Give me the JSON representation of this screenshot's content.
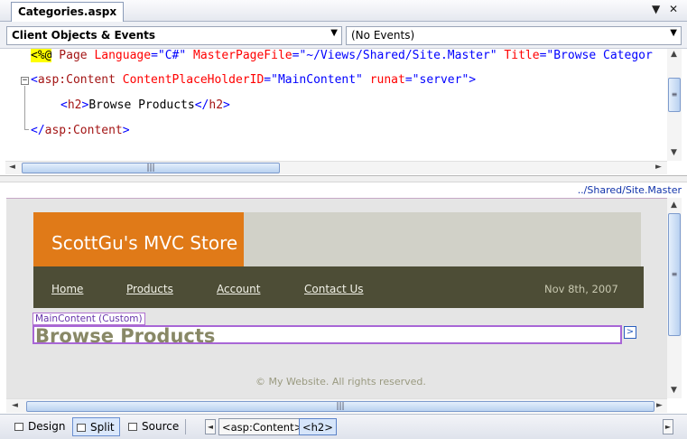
{
  "document_tab": {
    "title": "Categories.aspx"
  },
  "window_controls": {
    "menu": "▼",
    "close": "✕"
  },
  "dropdowns": {
    "objects": "Client Objects & Events",
    "events": "(No Events)"
  },
  "source": {
    "line1": {
      "open": "<%@",
      "directive": " Page",
      "attr1": " Language",
      "val1": "=\"C#\"",
      "attr2": " MasterPageFile",
      "val2": "=\"~/Views/Shared/Site.Master\"",
      "attr3": " Title",
      "val3": "=\"Browse Categor"
    },
    "line2": {
      "lt": "<",
      "tag": "asp:Content",
      "attr1": " ContentPlaceHolderID",
      "val1": "=\"MainContent\"",
      "attr2": " runat",
      "val2": "=\"server\"",
      "gt": ">"
    },
    "line3": {
      "lt": "<",
      "tag": "h2",
      "gt": ">",
      "text": "Browse Products",
      "lt2": "</",
      "tag2": "h2",
      "gt2": ">"
    },
    "line4": {
      "lt": "</",
      "tag": "asp:Content",
      "gt": ">"
    }
  },
  "master_link": "../Shared/Site.Master",
  "design": {
    "logo": "ScottGu's MVC Store",
    "nav": [
      "Home",
      "Products",
      "Account",
      "Contact Us"
    ],
    "date": "Nov 8th, 2007",
    "content_tag": "MainContent (Custom)",
    "heading": "Browse Products",
    "smart_tag": ">",
    "footer": "© My Website. All rights reserved."
  },
  "bottom": {
    "views": [
      "Design",
      "Split",
      "Source"
    ],
    "active_view": "Split",
    "breadcrumbs": [
      "<asp:Content>",
      "<h2>"
    ],
    "selected_crumb": "<h2>"
  },
  "colors": {
    "logo_bg": "#e07a18",
    "nav_bg": "#4d4d36",
    "header_bg": "#d1d1c8",
    "selection": "#a866d6"
  }
}
